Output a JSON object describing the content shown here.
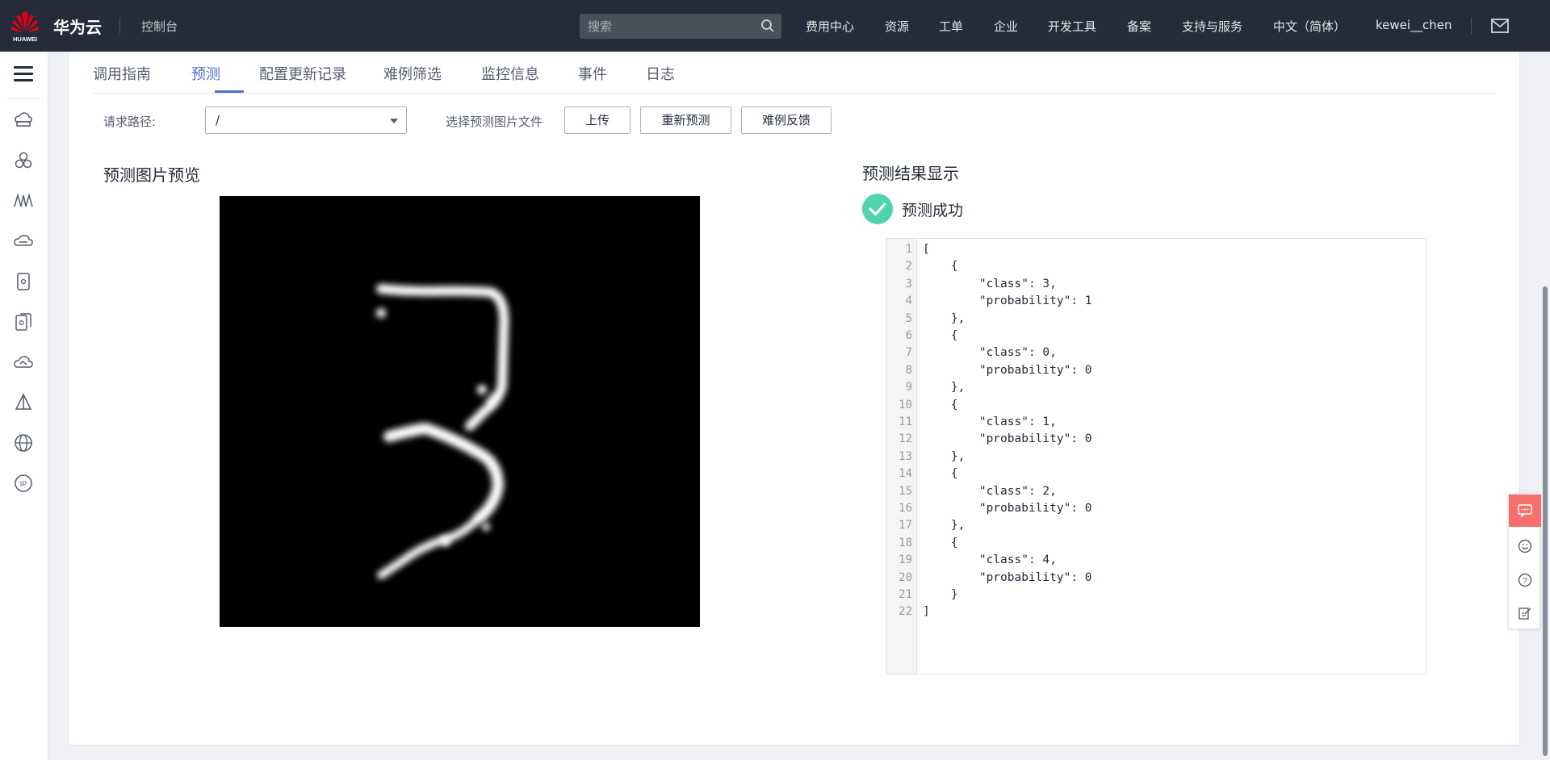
{
  "header": {
    "brand": "华为云",
    "logo_text": "HUAWEI",
    "console": "控制台",
    "search_placeholder": "搜索",
    "nav": [
      "费用中心",
      "资源",
      "工单",
      "企业",
      "开发工具",
      "备案",
      "支持与服务",
      "中文（简体）",
      "kewei__chen"
    ]
  },
  "tabs": [
    "调用指南",
    "预测",
    "配置更新记录",
    "难例筛选",
    "监控信息",
    "事件",
    "日志"
  ],
  "active_tab": "预测",
  "toolbar": {
    "path_label": "请求路径:",
    "path_value": "/",
    "choose_label": "选择预测图片文件",
    "upload": "上传",
    "repredict": "重新预测",
    "feedback": "难例反馈"
  },
  "preview": {
    "title": "预测图片预览"
  },
  "result": {
    "title": "预测结果显示",
    "status": "预测成功",
    "code_lines": [
      "[",
      "    {",
      "        \"class\": 3,",
      "        \"probability\": 1",
      "    },",
      "    {",
      "        \"class\": 0,",
      "        \"probability\": 0",
      "    },",
      "    {",
      "        \"class\": 1,",
      "        \"probability\": 0",
      "    },",
      "    {",
      "        \"class\": 2,",
      "        \"probability\": 0",
      "    },",
      "    {",
      "        \"class\": 4,",
      "        \"probability\": 0",
      "    }",
      "]"
    ]
  },
  "colors": {
    "topbar": "#252b3a",
    "accent": "#526ecc",
    "success": "#50d4ab",
    "brand_red": "#e60012",
    "float_chat": "#f66f6a"
  },
  "sidebar_icons": [
    "cloud-server-icon",
    "cluster-icon",
    "analytics-icon",
    "cloud-storage-icon",
    "database-icon",
    "database-group-icon",
    "cloud-upload-icon",
    "ai-model-icon",
    "globe-icon",
    "ip-icon"
  ],
  "float_tools": [
    "chat-icon",
    "smile-icon",
    "help-icon",
    "edit-icon"
  ]
}
